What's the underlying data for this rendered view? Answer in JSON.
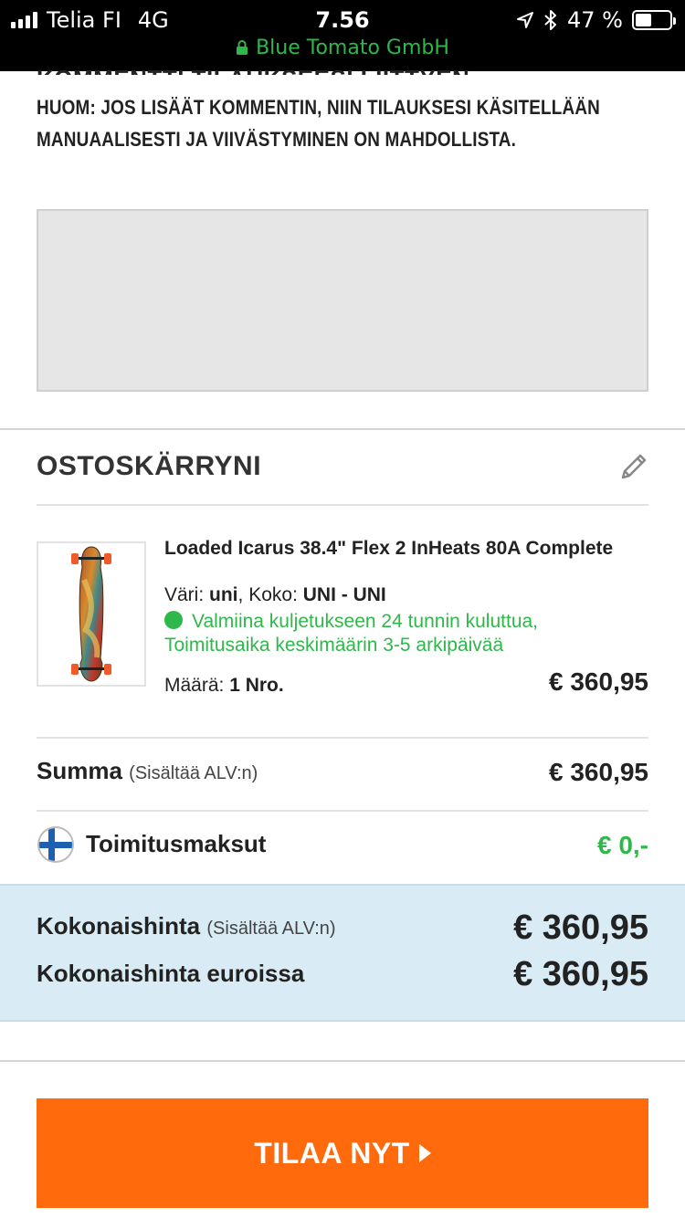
{
  "status_bar": {
    "carrier": "Telia FI",
    "network": "4G",
    "time": "7.56",
    "battery_text": "47 %",
    "battery_level": 0.47,
    "site": "Blue Tomato GmbH"
  },
  "comment": {
    "heading": "KOMMENTTI TILAUKSEESI LIITTYEN",
    "note": "HUOM: JOS LISÄÄT KOMMENTIN, NIIN TILAUKSESI KÄSITELLÄÄN MANUAALISESTI JA VIIVÄSTYMINEN ON MAHDOLLISTA.",
    "textarea_value": ""
  },
  "cart": {
    "title": "OSTOSKÄRRYNI",
    "edit_icon": "pencil-icon",
    "item": {
      "name": "Loaded Icarus 38.4\" Flex 2 InHeats 80A Complete",
      "color_label": "Väri:",
      "color_value": "uni",
      "size_label": "Koko:",
      "size_value": "UNI - UNI",
      "availability": "Valmiina kuljetukseen 24 tunnin kuluttua, Toimitusaika keskimäärin 3-5 arkipäivää",
      "qty_label": "Määrä:",
      "qty_value": "1 Nro.",
      "price": "€ 360,95"
    }
  },
  "summary": {
    "sum_label": "Summa",
    "sum_note": "(Sisältää ALV:n)",
    "sum_value": "€ 360,95",
    "shipping_label": "Toimitusmaksut",
    "shipping_value": "€ 0,-",
    "total_label": "Kokonaishinta",
    "total_note": "(Sisältää ALV:n)",
    "total_value": "€ 360,95",
    "total_eur_label": "Kokonaishinta euroissa",
    "total_eur_value": "€ 360,95"
  },
  "order_button": {
    "label": "TILAA NYT"
  },
  "colors": {
    "accent": "#ff6a0c",
    "success": "#2fb84a",
    "total_band": "#d9ebf4"
  }
}
